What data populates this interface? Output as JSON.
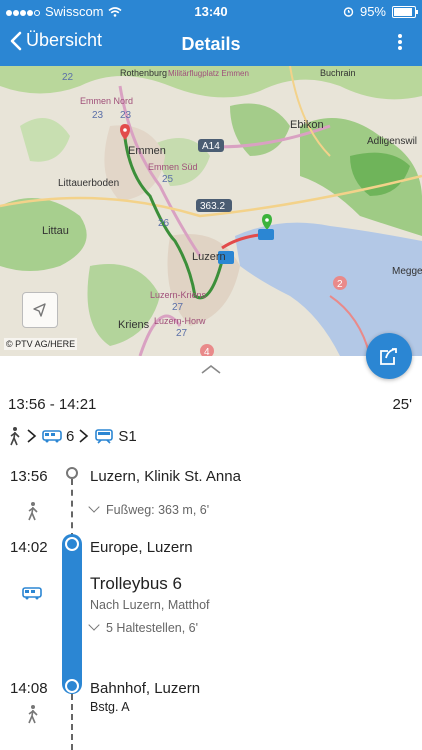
{
  "status": {
    "carrier": "Swisscom",
    "time": "13:40",
    "battery": "95%",
    "battery_level": 0.95
  },
  "nav": {
    "back_label": "Übersicht",
    "title": "Details"
  },
  "map": {
    "copyright": "© PTV AG/HERE",
    "labels": {
      "emmen": "Emmen",
      "emmen_nord": "Emmen Nord",
      "emmen_sued": "Emmen Süd",
      "ebikon": "Ebikon",
      "adligenswil": "Adligenswil",
      "littau": "Littau",
      "littauerboden": "Littauerboden",
      "luzern": "Luzern",
      "kriens": "Kriens",
      "luzern_kriens": "Luzern-Kriens",
      "luzern_horw": "Luzern-Horw",
      "meggen": "Megge",
      "a14": "A14",
      "r3632": "363.2",
      "buchrain": "Buchrain",
      "rothenburg": "Rothenburg",
      "mil": "Militärflugplatz Emmen",
      "n22": "22",
      "n23": "23",
      "n23b": "23",
      "n25": "25",
      "n26": "26",
      "n27": "27",
      "n27b": "27",
      "n2": "2",
      "n4": "4"
    }
  },
  "journey": {
    "time_range": "13:56 - 14:21",
    "duration": "25'",
    "bus_line": "6",
    "train_line": "S1"
  },
  "steps": {
    "s1_time": "13:56",
    "s1_place": "Luzern, Klinik St. Anna",
    "s1_walk": "Fußweg: 363 m, 6'",
    "s2_time": "14:02",
    "s2_place": "Europe, Luzern",
    "s2_line": "Trolleybus 6",
    "s2_direction": "Nach Luzern, Matthof",
    "s2_stops": "5 Haltestellen, 6'",
    "s3_time": "14:08",
    "s3_place": "Bahnhof, Luzern",
    "s3_platform": "Bstg. A"
  },
  "colors": {
    "accent": "#2b86d3",
    "route_green": "#3c8f3a",
    "route_red": "#e24b4b"
  }
}
